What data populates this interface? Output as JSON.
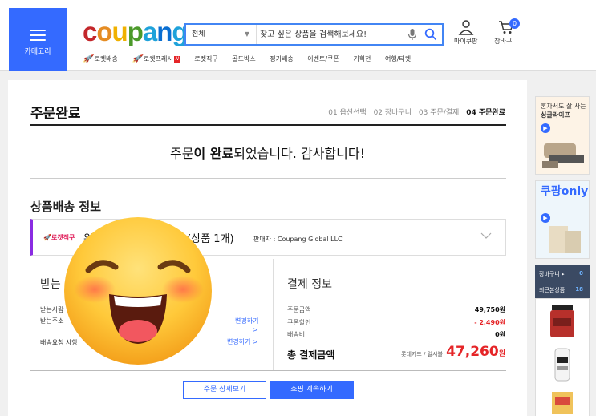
{
  "header": {
    "category_label": "카테고리",
    "logo_letters": [
      "c",
      "o",
      "u",
      "p",
      "a",
      "n",
      "g"
    ],
    "search_scope": "전체",
    "search_placeholder": "찾고 싶은 상품을 검색해보세요!",
    "mypage_label": "마이쿠팡",
    "cart_label": "장바구니",
    "cart_count": "0",
    "subnav": {
      "rocket": "로켓배송",
      "rocket_fresh": "로켓프레시",
      "fresh_badge": "N",
      "items": [
        "로켓직구",
        "골드박스",
        "정기배송",
        "이벤트/쿠폰",
        "기획전",
        "여행/티켓"
      ]
    }
  },
  "order": {
    "title": "주문완료",
    "steps": [
      "01 옵션선택",
      "02 장바구니",
      "03 주문/결제",
      "04 주문완료"
    ],
    "message_pre": "주문",
    "message_mid": "이 ",
    "message_bold": "완료",
    "message_post": "되었습니다. 감사합니다!",
    "shipping_title": "상품배송 정보",
    "shipment": {
      "badge": "로켓직구",
      "title_start": "왼",
      "title_end": ") (상품 1개)",
      "seller": "판매자 : Coupang Global LLC"
    }
  },
  "receiver": {
    "title": "받는",
    "rows": [
      "받는사람",
      "받는주소",
      "배송요청 사항"
    ],
    "edit1": "변경하기",
    "edit_arrow": ">",
    "edit2": "변경하기 >"
  },
  "payment": {
    "title": "결제 정보",
    "rows": [
      {
        "label": "주문금액",
        "value": "49,750원"
      },
      {
        "label": "쿠폰할인",
        "value": "- 2,490원"
      },
      {
        "label": "배송비",
        "value": "0원"
      }
    ],
    "total_label": "총 결제금액",
    "total_method": "롯데카드 / 일시불",
    "total_amount": "47,260",
    "total_unit": "원"
  },
  "buttons": {
    "detail": "주문 상세보기",
    "continue": "쇼핑 계속하기"
  },
  "rail": {
    "ad1": [
      "혼자서도 잘 사는",
      "싱글라이프"
    ],
    "ad2": "쿠팡only",
    "cart_label": "장바구니 ▸",
    "cart_count": "0",
    "recent_label": "최근본상품",
    "recent_count": "18"
  },
  "colors": {
    "accent": "#346aff",
    "price_red": "#e52528"
  }
}
